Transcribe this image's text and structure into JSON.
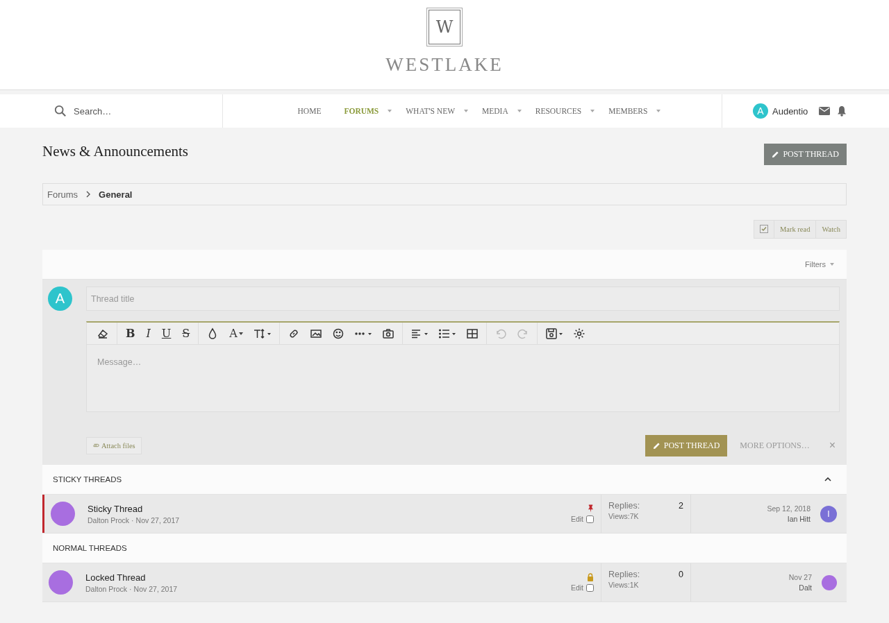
{
  "logo": {
    "mark": "W",
    "name": "WESTLAKE"
  },
  "nav": {
    "search": {
      "placeholder": "Search…"
    },
    "items": [
      {
        "label": "HOME",
        "selected": false,
        "dropdown": false
      },
      {
        "label": "FORUMS",
        "selected": true,
        "dropdown": true
      },
      {
        "label": "WHAT'S NEW",
        "selected": false,
        "dropdown": true
      },
      {
        "label": "MEDIA",
        "selected": false,
        "dropdown": true
      },
      {
        "label": "RESOURCES",
        "selected": false,
        "dropdown": true
      },
      {
        "label": "MEMBERS",
        "selected": false,
        "dropdown": true
      }
    ],
    "user": {
      "initial": "A",
      "name": "Audentio"
    }
  },
  "page": {
    "title": "News & Announcements",
    "post_button": "POST THREAD"
  },
  "breadcrumb": [
    "Forums",
    "General"
  ],
  "actions": [
    "Mark read",
    "Watch"
  ],
  "filters": "Filters",
  "composer": {
    "avatar": "A",
    "title_placeholder": "Thread title",
    "toolbar": [
      [
        {
          "kind": "icon",
          "dropdown": false,
          "disabled": false
        }
      ],
      [
        {
          "kind": "letter",
          "label": "B",
          "dropdown": false,
          "disabled": false
        },
        {
          "kind": "letter",
          "label": "I",
          "dropdown": false,
          "disabled": false
        },
        {
          "kind": "letter",
          "label": "U",
          "dropdown": false,
          "disabled": false
        },
        {
          "kind": "letter",
          "label": "S",
          "dropdown": false,
          "disabled": false
        }
      ],
      [
        {
          "kind": "icon",
          "dropdown": false,
          "disabled": false
        },
        {
          "kind": "letter",
          "label": "A",
          "dropdown": true,
          "disabled": false
        },
        {
          "kind": "icon",
          "dropdown": true,
          "disabled": false
        }
      ],
      [
        {
          "kind": "icon",
          "dropdown": false,
          "disabled": false
        },
        {
          "kind": "icon",
          "dropdown": false,
          "disabled": false
        },
        {
          "kind": "icon",
          "dropdown": false,
          "disabled": false
        },
        {
          "kind": "icon",
          "dropdown": true,
          "disabled": false
        },
        {
          "kind": "icon",
          "dropdown": false,
          "disabled": false
        }
      ],
      [
        {
          "kind": "icon",
          "dropdown": true,
          "disabled": false
        },
        {
          "kind": "icon",
          "dropdown": true,
          "disabled": false
        },
        {
          "kind": "icon",
          "dropdown": false,
          "disabled": false
        }
      ],
      [
        {
          "kind": "icon",
          "dropdown": false,
          "disabled": true
        },
        {
          "kind": "icon",
          "dropdown": false,
          "disabled": true
        }
      ],
      [
        {
          "kind": "icon",
          "dropdown": true,
          "disabled": false
        },
        {
          "kind": "icon",
          "dropdown": false,
          "disabled": false
        }
      ]
    ],
    "message_placeholder": "Message…",
    "attach": "Attach files",
    "post": "POST THREAD",
    "more": "MORE OPTIONS…",
    "close": "×"
  },
  "sections": [
    {
      "title": "STICKY THREADS",
      "collapsible": true,
      "threads": [
        {
          "kind": "sticky",
          "title": "Sticky Thread",
          "author": "Dalton Prock",
          "separator": "·",
          "date": "Nov 27, 2017",
          "edit": "Edit",
          "replies_label": "Replies:",
          "replies": "2",
          "views_label": "Views:",
          "views": "7K",
          "last_date": "Sep 12, 2018",
          "last_user": "Ian Hitt",
          "last_initial": "I"
        }
      ]
    },
    {
      "title": "NORMAL THREADS",
      "collapsible": false,
      "threads": [
        {
          "kind": "locked",
          "title": "Locked Thread",
          "author": "Dalton Prock",
          "separator": "·",
          "date": "Nov 27, 2017",
          "edit": "Edit",
          "replies_label": "Replies:",
          "replies": "0",
          "views_label": "Views:",
          "views": "1K",
          "last_date": "Nov 27",
          "last_user": "Dalt"
        }
      ]
    }
  ]
}
